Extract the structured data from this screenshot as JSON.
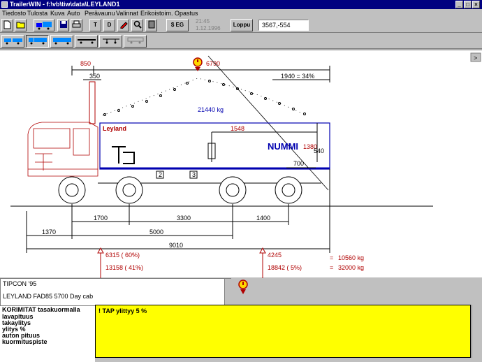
{
  "window": {
    "title": "TrailerWIN - f:\\vb\\tiw\\data\\LEYLAND1",
    "min": "_",
    "max": "□",
    "close": "×"
  },
  "menu": [
    "Tiedosto",
    "Tulosta",
    "Kuva",
    "Auto",
    "Perävaunu",
    "Valinnat",
    "Erikoistoim.",
    "Opastus"
  ],
  "toolbar": {
    "t_label": "T",
    "d_label": "D",
    "seg_label": "$ EG",
    "time": "21:45",
    "date": "1.12.1996",
    "loppu_label": "Loppu",
    "coords": "3567,-554",
    "scroll_right": ">"
  },
  "drawing": {
    "dims": {
      "d850": "850",
      "d350": "350",
      "d6790": "6790",
      "d1940": "1940 = 34%",
      "load": "21440 kg",
      "body_brand": "Leyland",
      "d1548": "1548",
      "nummi": "NUMMI",
      "d1380": "1380",
      "d540": "540",
      "d700": "700",
      "d1700": "1700",
      "d3300": "3300",
      "d1400": "1400",
      "d1370": "1370",
      "d5000": "5000",
      "d9010": "9010",
      "box1": "2",
      "box2": "3"
    },
    "front_axle": {
      "line1": "6315 ( 60%)",
      "line2": "13158 ( 41%)"
    },
    "rear_axle": {
      "line1": "4245",
      "line2": "18842 ( 5%)"
    },
    "totals": {
      "eq1": "=",
      "val1": "10560 kg",
      "eq2": "=",
      "val2": "32000 kg"
    }
  },
  "info": {
    "line1": "TIPCON '95",
    "line2": "LEYLAND FAD85 5700 Day cab"
  },
  "labels": {
    "header": "KORIMITAT tasakuormalla",
    "items": [
      "lavapituus",
      "takaylitys",
      "ylitys %",
      "auton pituus",
      "kuormituspiste"
    ]
  },
  "message": "! TAP ylittyy   5 %",
  "colors": {
    "title_bar": "#000080",
    "dim_red": "#b00000",
    "body_blue": "#0000b0",
    "msg_bg": "#ffff00"
  }
}
